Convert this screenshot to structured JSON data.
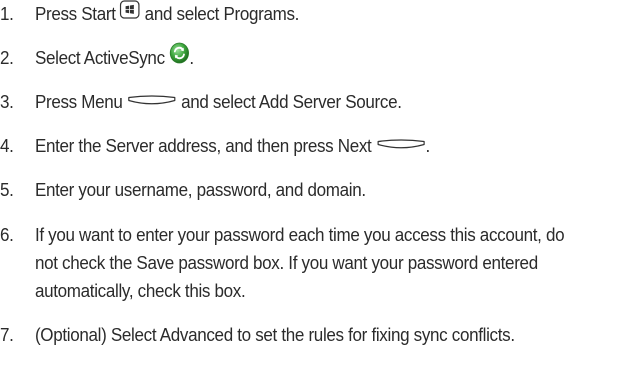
{
  "steps": [
    {
      "number": "1.",
      "part1": "Press Start",
      "part2": "and select Programs.",
      "icon": "start-button-icon"
    },
    {
      "number": "2.",
      "part1": "Select ActiveSync",
      "part2": ".",
      "icon": "activesync-icon"
    },
    {
      "number": "3.",
      "part1": "Press Menu",
      "part2": "and select Add Server Source.",
      "icon": "softkey-icon"
    },
    {
      "number": "4.",
      "part1": "Enter the Server address, and then press Next",
      "part2": ".",
      "icon": "softkey-icon"
    },
    {
      "number": "5.",
      "text": "Enter your username, password, and domain."
    },
    {
      "number": "6.",
      "text": "If you want to enter your password each time you access this account, do not check the Save password box. If you want your password entered automatically, check this box."
    },
    {
      "number": "7.",
      "text": "(Optional) Select Advanced to set the rules for fixing sync conflicts."
    }
  ],
  "colors": {
    "text": "#2b2b2b",
    "activesync_green": "#3aa33a"
  }
}
